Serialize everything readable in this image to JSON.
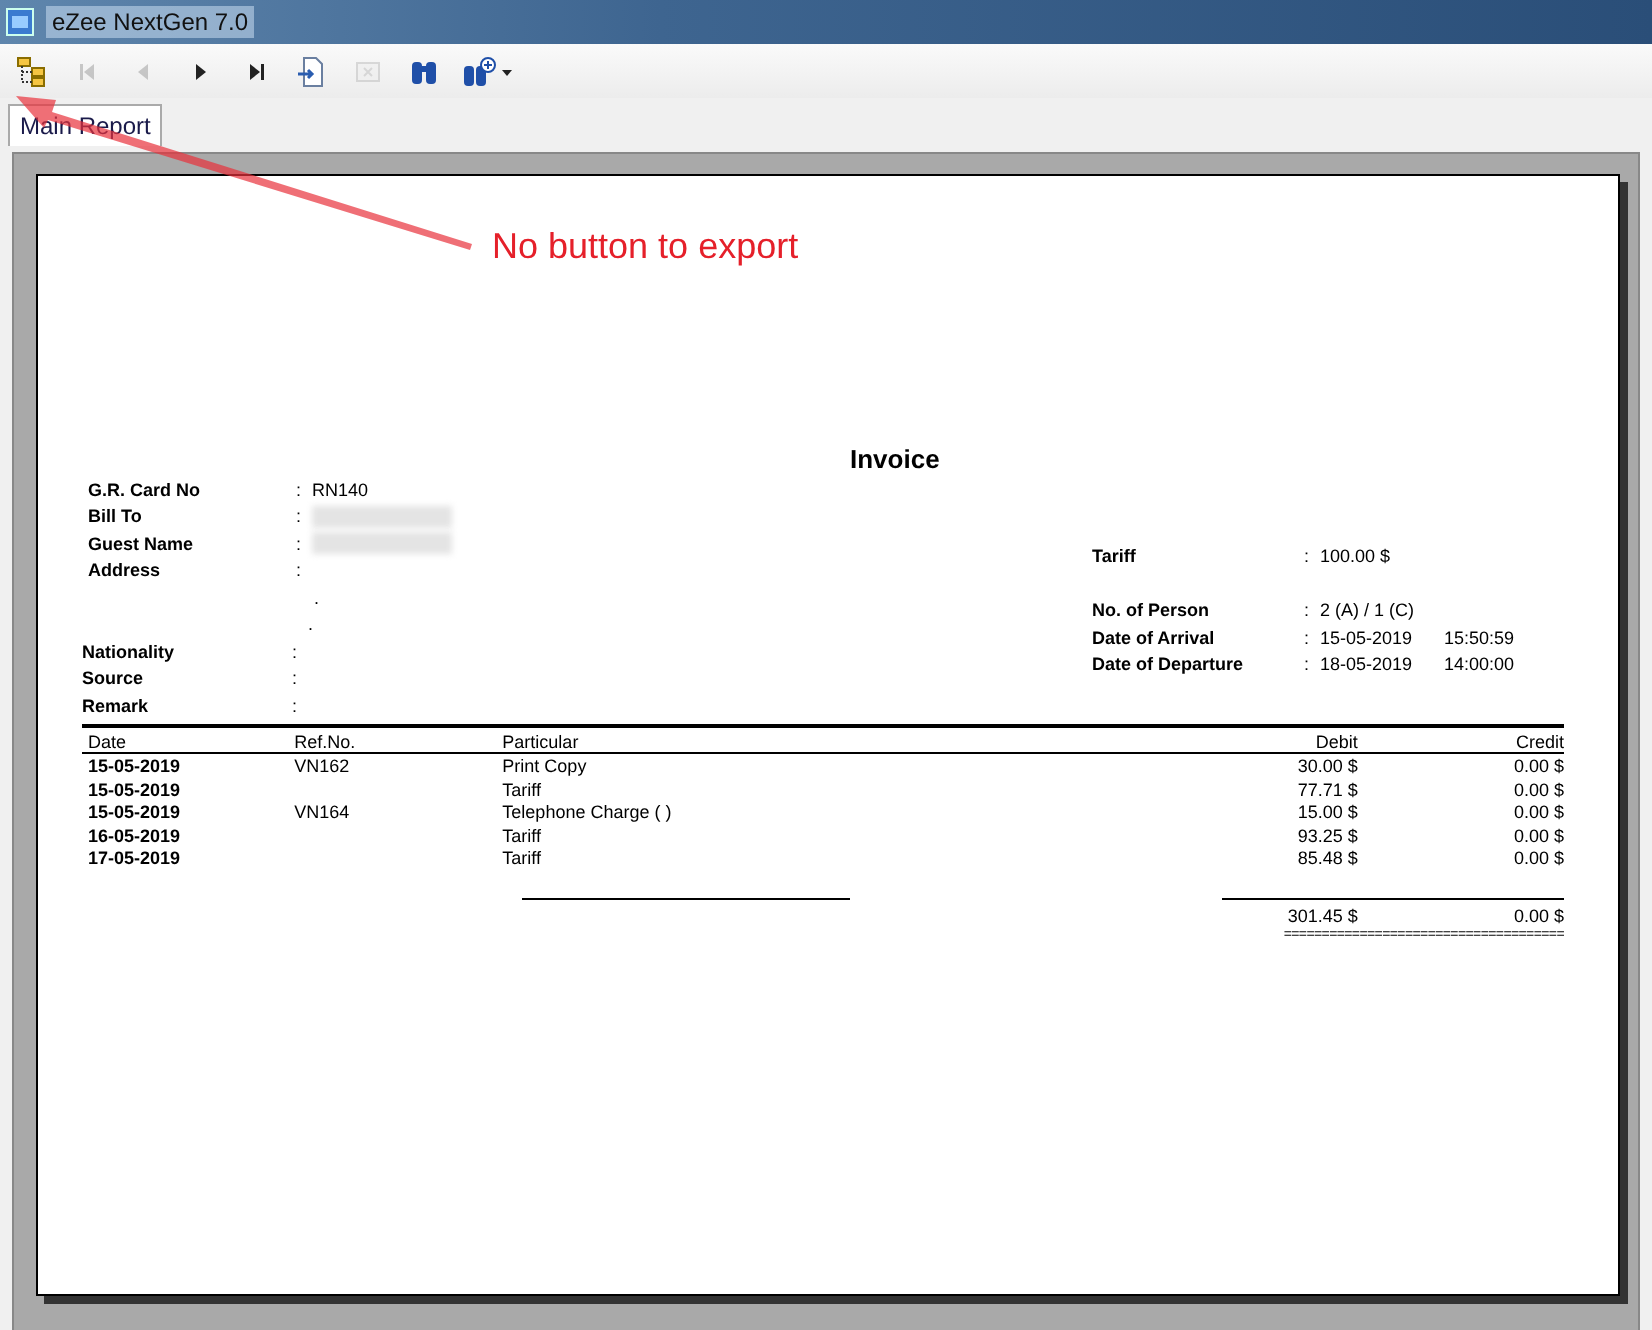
{
  "window": {
    "title": "eZee NextGen 7.0"
  },
  "toolbar": [
    {
      "kind": "tree",
      "disabled": false
    },
    {
      "kind": "first",
      "disabled": true
    },
    {
      "kind": "prev",
      "disabled": true
    },
    {
      "kind": "next",
      "disabled": false
    },
    {
      "kind": "last",
      "disabled": false
    },
    {
      "kind": "goto",
      "disabled": false
    },
    {
      "kind": "stop",
      "disabled": true
    },
    {
      "kind": "find",
      "disabled": false
    },
    {
      "kind": "zoom",
      "disabled": false
    }
  ],
  "tabs": [
    {
      "label": "Main Report",
      "selected": true
    }
  ],
  "report": {
    "title": "Invoice",
    "left_fields": [
      {
        "label": "G.R. Card No",
        "colon": ":",
        "value": "RN140",
        "redacted": false
      },
      {
        "label": "Bill To",
        "colon": ":",
        "redacted": true
      },
      {
        "label": "Guest Name",
        "colon": ":",
        "redacted": true
      },
      {
        "label": "Address",
        "colon": ":",
        "redacted": false
      }
    ],
    "address_marks": [
      ".",
      "."
    ],
    "left_fields_2": [
      {
        "label": "Nationality",
        "colon": ":"
      },
      {
        "label": "Source",
        "colon": ":"
      },
      {
        "label": "Remark",
        "colon": ":"
      }
    ],
    "right_fields": [
      {
        "label": "Tariff",
        "colon": ":",
        "value": "100.00 $"
      },
      {
        "label": "No. of Person",
        "colon": ":",
        "value": "2 (A)  / 1 (C)"
      },
      {
        "label": "Date of Arrival",
        "colon": ":",
        "value": "15-05-2019",
        "time": "15:50:59"
      },
      {
        "label": "Date of Departure",
        "colon": ":",
        "value": "18-05-2019",
        "time": "14:00:00"
      }
    ],
    "columns": [
      "Date",
      "Ref.No.",
      "Particular",
      "Debit",
      "Credit"
    ],
    "rows": [
      [
        "15-05-2019",
        "VN162",
        "Print Copy",
        "30.00 $",
        "0.00 $"
      ],
      [
        "15-05-2019",
        null,
        "Tariff",
        "77.71 $",
        "0.00 $"
      ],
      [
        "15-05-2019",
        "VN164",
        "Telephone Charge ( )",
        "15.00 $",
        "0.00 $"
      ],
      [
        "16-05-2019",
        null,
        "Tariff",
        "93.25 $",
        "0.00 $"
      ],
      [
        "17-05-2019",
        null,
        "Tariff",
        "85.48 $",
        "0.00 $"
      ]
    ],
    "total_debit": "301.45 $",
    "total_credit": "0.00 $",
    "double_rule": "====================================="
  },
  "annotation": {
    "text": "No button to export"
  }
}
